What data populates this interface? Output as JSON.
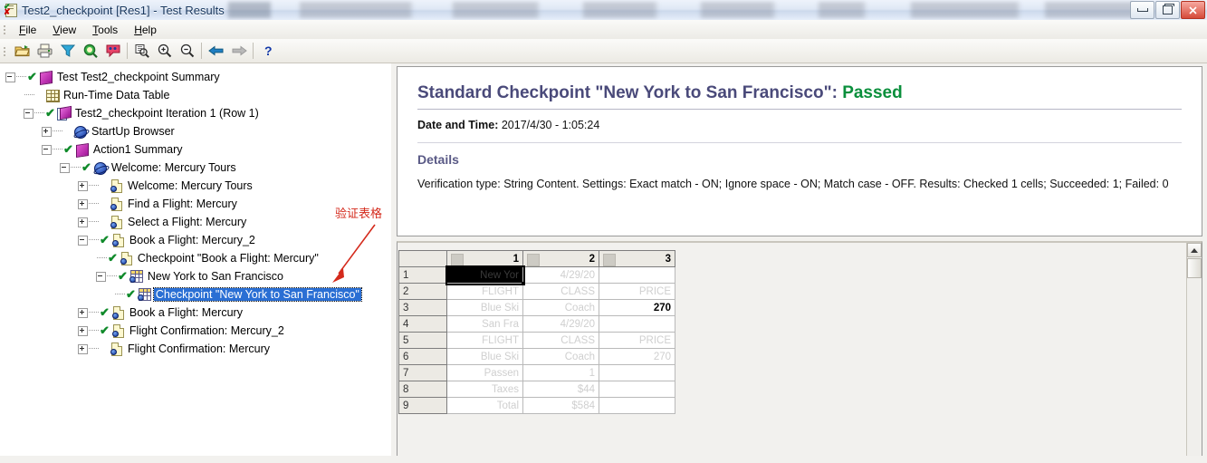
{
  "window": {
    "title": "Test2_checkpoint [Res1] - Test Results",
    "icon": "test-results-icon",
    "buttons": {
      "minimize": "minimize-button",
      "restore": "restore-button",
      "close": "close-button"
    }
  },
  "menubar": {
    "items": [
      {
        "label": "File",
        "accel": "F"
      },
      {
        "label": "View",
        "accel": "V"
      },
      {
        "label": "Tools",
        "accel": "T"
      },
      {
        "label": "Help",
        "accel": "H"
      }
    ]
  },
  "toolbar": {
    "buttons": [
      {
        "name": "open-icon",
        "title": "Open"
      },
      {
        "name": "print-icon",
        "title": "Print"
      },
      {
        "name": "filter-icon",
        "title": "Filter"
      },
      {
        "name": "find-icon",
        "title": "Find"
      },
      {
        "name": "defect-icon",
        "title": "Add Defect"
      },
      {
        "name": "zoom-fit-icon",
        "title": "Fit to Window"
      },
      {
        "name": "zoom-in-icon",
        "title": "Zoom In"
      },
      {
        "name": "zoom-out-icon",
        "title": "Zoom Out"
      },
      {
        "name": "back-arrow-icon",
        "title": "Back"
      },
      {
        "name": "forward-arrow-icon",
        "title": "Forward"
      },
      {
        "name": "help-icon",
        "title": "Help"
      }
    ]
  },
  "tree": {
    "nodes": [
      {
        "id": "test-summary",
        "label": "Test Test2_checkpoint Summary",
        "depth": 0,
        "twisty": "minus",
        "check": true,
        "icon": "test-summary-icon"
      },
      {
        "id": "runtime-data-table",
        "label": "Run-Time Data Table",
        "depth": 1,
        "twisty": "none",
        "check": false,
        "icon": "data-table-icon"
      },
      {
        "id": "iteration-1",
        "label": "Test2_checkpoint Iteration 1 (Row 1)",
        "depth": 1,
        "twisty": "minus",
        "check": true,
        "icon": "iteration-icon"
      },
      {
        "id": "startup-browser",
        "label": "StartUp Browser",
        "depth": 2,
        "twisty": "plus",
        "check": false,
        "icon": "browser-icon"
      },
      {
        "id": "action1-summary",
        "label": "Action1 Summary",
        "depth": 2,
        "twisty": "minus",
        "check": true,
        "icon": "action-icon"
      },
      {
        "id": "welcome-mercury-tours",
        "label": "Welcome: Mercury Tours",
        "depth": 3,
        "twisty": "minus",
        "check": true,
        "icon": "browser-icon"
      },
      {
        "id": "welcome-page",
        "label": "Welcome: Mercury Tours",
        "depth": 4,
        "twisty": "plus",
        "check": false,
        "icon": "page-icon"
      },
      {
        "id": "find-a-flight",
        "label": "Find a Flight: Mercury",
        "depth": 4,
        "twisty": "plus",
        "check": false,
        "icon": "page-icon"
      },
      {
        "id": "select-a-flight",
        "label": "Select a Flight: Mercury",
        "depth": 4,
        "twisty": "plus",
        "check": false,
        "icon": "page-icon"
      },
      {
        "id": "book-a-flight-2",
        "label": "Book a Flight: Mercury_2",
        "depth": 4,
        "twisty": "minus",
        "check": true,
        "icon": "page-icon"
      },
      {
        "id": "checkpoint-book",
        "label": "Checkpoint \"Book a Flight: Mercury\"",
        "depth": 5,
        "twisty": "none",
        "check": true,
        "icon": "page-icon"
      },
      {
        "id": "new-york-to-sf",
        "label": "New York to San Francisco",
        "depth": 5,
        "twisty": "minus",
        "check": true,
        "icon": "table-icon"
      },
      {
        "id": "checkpoint-ny-sf",
        "label": "Checkpoint \"New York to San Francisco\"",
        "depth": 6,
        "twisty": "none",
        "check": true,
        "icon": "table-icon",
        "selected": true
      },
      {
        "id": "book-a-flight",
        "label": "Book a Flight: Mercury",
        "depth": 4,
        "twisty": "plus",
        "check": true,
        "icon": "page-icon"
      },
      {
        "id": "flight-confirm-2",
        "label": "Flight Confirmation: Mercury_2",
        "depth": 4,
        "twisty": "plus",
        "check": true,
        "icon": "page-icon"
      },
      {
        "id": "flight-confirm",
        "label": "Flight Confirmation: Mercury",
        "depth": 4,
        "twisty": "plus",
        "check": false,
        "icon": "page-icon"
      }
    ]
  },
  "annotation": {
    "text": "验证表格",
    "color": "#d42a1c"
  },
  "result": {
    "heading_prefix": "Standard Checkpoint \"New York to San Francisco\": ",
    "status": "Passed",
    "status_color": "#0a8f3c",
    "date_label": "Date and Time:",
    "date_value": "2017/4/30 - 1:05:24",
    "details_heading": "Details",
    "details_text": "Verification type: String Content. Settings: Exact match - ON; Ignore space - ON; Match case - OFF. Results: Checked 1 cells; Succeeded: 1; Failed: 0"
  },
  "datatable": {
    "corner": "",
    "columns": [
      "1",
      "2",
      "3"
    ],
    "rows": [
      {
        "num": "1",
        "cells": [
          {
            "v": "New Yor",
            "state": "selected"
          },
          {
            "v": "4/29/20",
            "state": "dim"
          },
          {
            "v": "",
            "state": "dim"
          }
        ]
      },
      {
        "num": "2",
        "cells": [
          {
            "v": "FLIGHT",
            "state": "dim"
          },
          {
            "v": "CLASS",
            "state": "dim"
          },
          {
            "v": "PRICE",
            "state": "dim"
          }
        ]
      },
      {
        "num": "3",
        "cells": [
          {
            "v": "Blue Ski",
            "state": "dim"
          },
          {
            "v": "Coach",
            "state": "dim"
          },
          {
            "v": "270",
            "state": "strong"
          }
        ]
      },
      {
        "num": "4",
        "cells": [
          {
            "v": "San Fra",
            "state": "dim"
          },
          {
            "v": "4/29/20",
            "state": "dim"
          },
          {
            "v": "",
            "state": "dim"
          }
        ]
      },
      {
        "num": "5",
        "cells": [
          {
            "v": "FLIGHT",
            "state": "dim"
          },
          {
            "v": "CLASS",
            "state": "dim"
          },
          {
            "v": "PRICE",
            "state": "dim"
          }
        ]
      },
      {
        "num": "6",
        "cells": [
          {
            "v": "Blue Ski",
            "state": "dim"
          },
          {
            "v": "Coach",
            "state": "dim"
          },
          {
            "v": "270",
            "state": "dim"
          }
        ]
      },
      {
        "num": "7",
        "cells": [
          {
            "v": "Passen",
            "state": "dim"
          },
          {
            "v": "1",
            "state": "dim"
          },
          {
            "v": "",
            "state": "dim"
          }
        ]
      },
      {
        "num": "8",
        "cells": [
          {
            "v": "Taxes",
            "state": "dim"
          },
          {
            "v": "$44",
            "state": "dim"
          },
          {
            "v": "",
            "state": "dim"
          }
        ]
      },
      {
        "num": "9",
        "cells": [
          {
            "v": "Total",
            "state": "dim"
          },
          {
            "v": "$584",
            "state": "dim"
          },
          {
            "v": "",
            "state": "dim"
          }
        ]
      }
    ]
  },
  "scrollbar": {
    "up_arrow": "scroll-up-arrow-icon",
    "thumb": "scroll-thumb"
  }
}
